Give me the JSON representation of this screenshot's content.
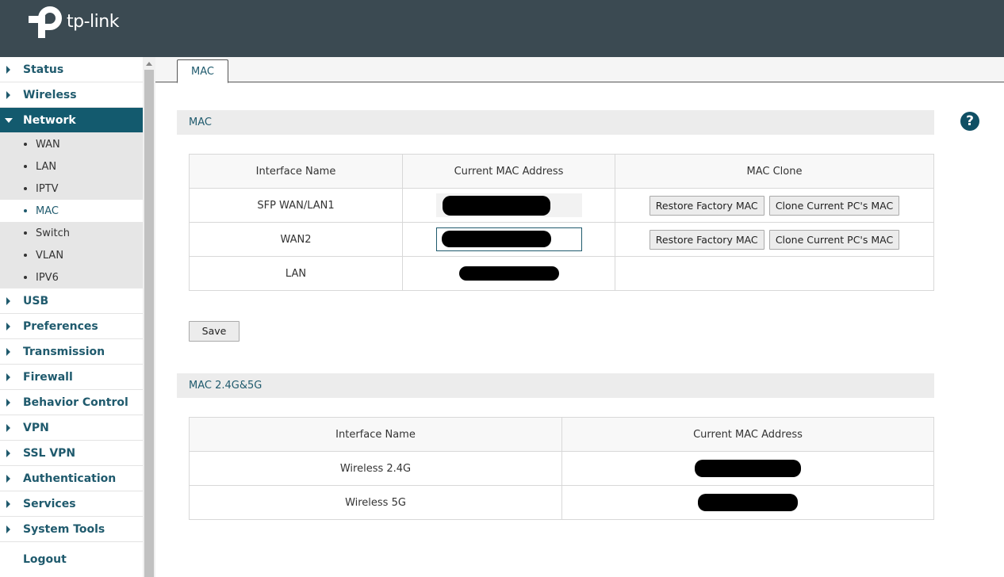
{
  "header": {
    "brand": "tp-link"
  },
  "sidebar": {
    "items": [
      {
        "label": "Status"
      },
      {
        "label": "Wireless"
      },
      {
        "label": "Network"
      },
      {
        "label": "USB"
      },
      {
        "label": "Preferences"
      },
      {
        "label": "Transmission"
      },
      {
        "label": "Firewall"
      },
      {
        "label": "Behavior Control"
      },
      {
        "label": "VPN"
      },
      {
        "label": "SSL VPN"
      },
      {
        "label": "Authentication"
      },
      {
        "label": "Services"
      },
      {
        "label": "System Tools"
      }
    ],
    "network_sub": [
      "WAN",
      "LAN",
      "IPTV",
      "MAC",
      "Switch",
      "VLAN",
      "IPV6"
    ],
    "logout": "Logout"
  },
  "tabs": [
    {
      "label": "MAC"
    }
  ],
  "mac_section": {
    "title": "MAC",
    "headers": [
      "Interface Name",
      "Current MAC Address",
      "MAC Clone"
    ],
    "rows": [
      {
        "name": "SFP WAN/LAN1"
      },
      {
        "name": "WAN2"
      },
      {
        "name": "LAN"
      }
    ],
    "restore_label": "Restore Factory MAC",
    "clone_label": "Clone Current PC's MAC",
    "save_label": "Save"
  },
  "wireless_section": {
    "title": "MAC 2.4G&5G",
    "headers": [
      "Interface Name",
      "Current MAC Address"
    ],
    "rows": [
      {
        "name": "Wireless 2.4G"
      },
      {
        "name": "Wireless 5G"
      }
    ]
  },
  "help_label": "?",
  "colors": {
    "header_bg": "#3b4a52",
    "accent": "#135a6e",
    "link": "#1f5a6d"
  }
}
